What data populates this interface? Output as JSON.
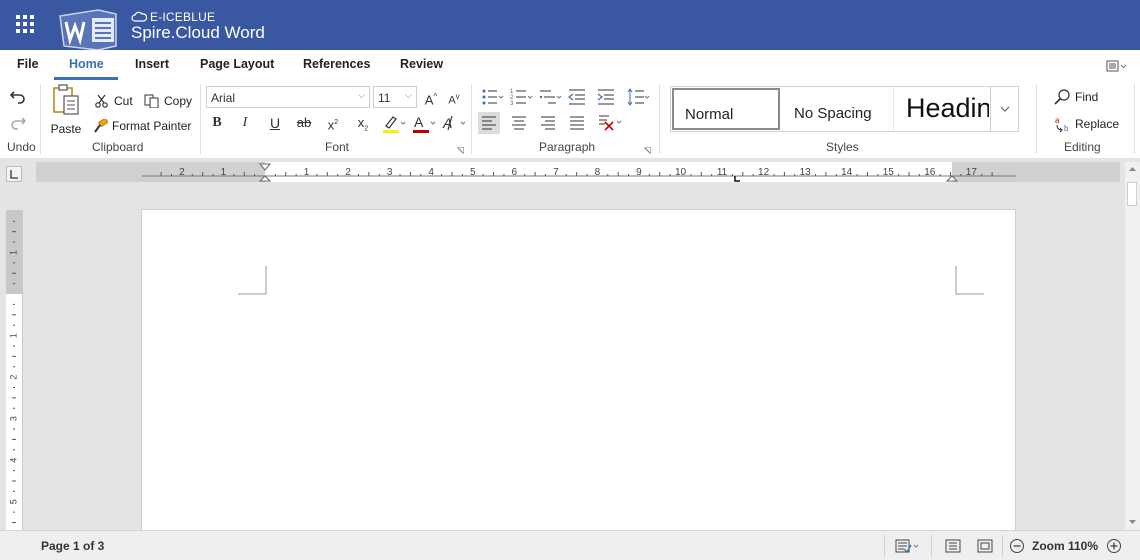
{
  "title_bar": {
    "brand": "E-ICEBLUE",
    "product": "Spire.Cloud Word",
    "colors": {
      "bar": "#3a57a1",
      "accent": "#3a6fb7"
    }
  },
  "menu_tabs": [
    {
      "label": "File"
    },
    {
      "label": "Home",
      "active": true
    },
    {
      "label": "Insert"
    },
    {
      "label": "Page Layout"
    },
    {
      "label": "References"
    },
    {
      "label": "Review"
    }
  ],
  "ribbon": {
    "undo": {
      "label": "Undo",
      "group": "Undo"
    },
    "clipboard": {
      "group": "Clipboard",
      "paste": "Paste",
      "cut": "Cut",
      "copy": "Copy",
      "format_painter": "Format Painter"
    },
    "font": {
      "group": "Font",
      "family": "Arial",
      "size": "11"
    },
    "paragraph": {
      "group": "Paragraph"
    },
    "styles": {
      "group": "Styles",
      "items": [
        "Normal",
        "No Spacing",
        "Headin"
      ]
    },
    "editing": {
      "group": "Editing",
      "find": "Find",
      "replace": "Replace"
    }
  },
  "ruler": {
    "h_labels": [
      "2",
      "1",
      "1",
      "2",
      "3",
      "4",
      "5",
      "6",
      "7",
      "8",
      "9",
      "10",
      "11",
      "12",
      "13",
      "14",
      "15",
      "16",
      "17"
    ],
    "v_labels": [
      "1",
      "1",
      "2",
      "3",
      "4",
      "5"
    ]
  },
  "status_bar": {
    "page_info": "Page 1 of 3",
    "zoom": "Zoom 110%"
  }
}
